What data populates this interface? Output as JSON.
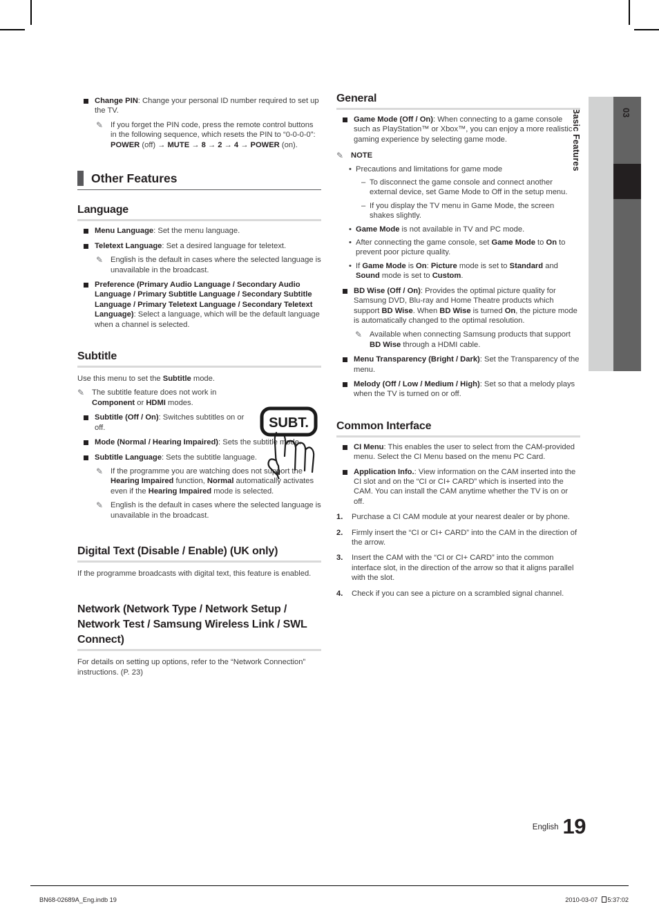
{
  "page": {
    "number": "19",
    "language_label": "English",
    "tab_number": "03",
    "tab_label": "Basic Features"
  },
  "footer": {
    "file": "BN68-02689A_Eng.indb   19",
    "date": "2010-03-07",
    "time": "5:37:02"
  },
  "left_column": {
    "change_pin": {
      "title": "Change PIN",
      "body": ": Change your personal ID number required to set up the TV.",
      "note": "If you forget the PIN code, press the remote control buttons in the following sequence, which resets the PIN to “0-0-0-0”: POWER (off) → MUTE → 8 → 2 → 4 → POWER (on)."
    },
    "section_heading": "Other Features",
    "language": {
      "heading": "Language",
      "menu_language_title": "Menu Language",
      "menu_language_body": ": Set the menu language.",
      "teletext_language_title": "Teletext Language",
      "teletext_language_body": ": Set a desired language for teletext.",
      "teletext_note": "English is the default in cases where the selected language is unavailable in the broadcast.",
      "preference_title": "Preference (Primary Audio Language / Secondary Audio Language / Primary Subtitle Language / Secondary Subtitle Language / Primary Teletext Language / Secondary Teletext Language)",
      "preference_body": ": Select a language, which will be the default language when a channel is selected."
    },
    "subtitle": {
      "heading": "Subtitle",
      "intro_pre": "Use this menu to set the ",
      "intro_bold": "Subtitle",
      "intro_post": " mode.",
      "note1": "The subtitle feature does not work in Component or HDMI modes.",
      "subtitle_onoff_title": "Subtitle (Off / On)",
      "subtitle_onoff_body": ": Switches subtitles on or off.",
      "mode_title": "Mode (Normal / Hearing Impaired)",
      "mode_body": ": Sets the subtitle mode.",
      "subtitle_language_title": "Subtitle Language",
      "subtitle_language_body": ": Sets the subtitle language.",
      "note2": "If the programme you are watching does not support the Hearing Impaired function, Normal automatically activates even if the Hearing Impaired mode is selected.",
      "note3": "English is the default in cases where the selected language is unavailable in the broadcast.",
      "remote_button_label": "SUBT."
    },
    "digital_text": {
      "heading": "Digital Text (Disable / Enable) (UK only)",
      "body": "If the programme broadcasts with digital text, this feature is enabled."
    },
    "network": {
      "heading": "Network (Network Type / Network Setup / Network Test / Samsung Wireless Link / SWL Connect)",
      "body": "For details on setting up options, refer to the “Network Connection” instructions. (P. 23)"
    }
  },
  "right_column": {
    "general": {
      "heading": "General",
      "game_mode_title": "Game Mode (Off / On)",
      "game_mode_body": ": When connecting to a game console such as PlayStation™ or Xbox™, you can enjoy a more realistic gaming experience by selecting game mode.",
      "note_label": "NOTE",
      "bullet1": "Precautions and limitations for game mode",
      "dash1": "To disconnect the game console and connect another external device, set Game Mode to Off in the setup menu.",
      "dash2": "If you display the TV menu in Game Mode, the screen shakes slightly.",
      "bullet2": "Game Mode is not available in TV and PC mode.",
      "bullet3": "After connecting the game console, set Game Mode to On to prevent poor picture quality.",
      "bullet4": "If Game Mode is On: Picture mode is set to Standard and Sound mode is set to Custom.",
      "bd_wise_title": "BD Wise (Off / On)",
      "bd_wise_body": ": Provides the optimal picture quality for Samsung DVD, Blu-ray and Home Theatre products which support BD Wise. When BD Wise is turned On, the picture mode is automatically changed to the optimal resolution.",
      "bd_wise_note": "Available when connecting Samsung products that support BD Wise through a HDMI cable.",
      "menu_transparency_title": "Menu Transparency (Bright / Dark)",
      "menu_transparency_body": ": Set the Transparency of the menu.",
      "melody_title": "Melody (Off / Low / Medium / High)",
      "melody_body": ": Set so that a melody plays when the TV is turned on or off."
    },
    "common_interface": {
      "heading": "Common Interface",
      "ci_menu_title": "CI Menu",
      "ci_menu_body": ":  This enables the user to select from the CAM-provided menu. Select the CI Menu based on the menu PC Card.",
      "app_info_title": "Application Info.",
      "app_info_body": ": View information on the CAM inserted into the CI slot and on the “CI or CI+ CARD” which is inserted into the CAM. You can install the CAM anytime whether the TV is on or off.",
      "steps": [
        {
          "n": "1.",
          "text": "Purchase a CI CAM module at your nearest dealer or by phone."
        },
        {
          "n": "2.",
          "text": "Firmly insert the “CI or CI+ CARD” into the CAM in the direction of the arrow."
        },
        {
          "n": "3.",
          "text": "Insert the CAM with the “CI or CI+ CARD” into the common interface slot, in the direction of the arrow so that it aligns parallel with the slot."
        },
        {
          "n": "4.",
          "text": "Check if you can see a picture on a scrambled signal channel."
        }
      ]
    }
  }
}
